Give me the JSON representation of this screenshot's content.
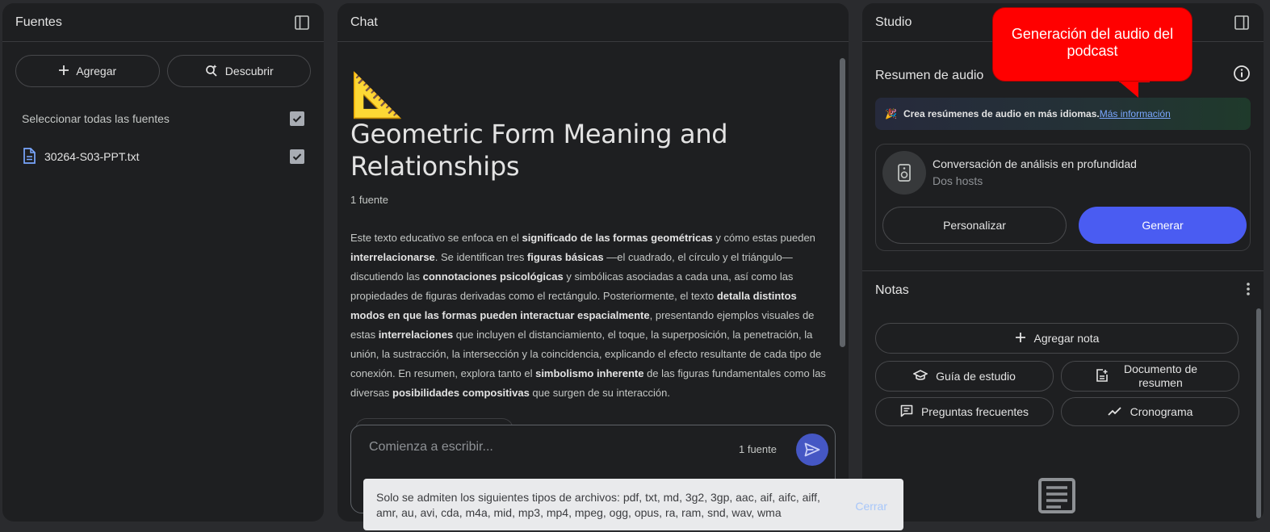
{
  "sources": {
    "title": "Fuentes",
    "add_label": "Agregar",
    "discover_label": "Descubrir",
    "select_all_label": "Seleccionar todas las fuentes",
    "items": [
      {
        "name": "30264-S03-PPT.txt",
        "checked": true
      }
    ]
  },
  "chat": {
    "title": "Chat",
    "emoji": "📐",
    "notebook_title": "Geometric Form Meaning and Relationships",
    "source_count": "1 fuente",
    "summary_parts": [
      {
        "t": "Este texto educativo se enfoca en el ",
        "b": false
      },
      {
        "t": "significado de las formas geométricas",
        "b": true
      },
      {
        "t": " y cómo estas pueden ",
        "b": false
      },
      {
        "t": "interrelacionarse",
        "b": true
      },
      {
        "t": ". Se identifican tres ",
        "b": false
      },
      {
        "t": "figuras básicas",
        "b": true
      },
      {
        "t": " —el cuadrado, el círculo y el triángulo— discutiendo las ",
        "b": false
      },
      {
        "t": "connotaciones psicológicas",
        "b": true
      },
      {
        "t": " y simbólicas asociadas a cada una, así como las propiedades de figuras derivadas como el rectángulo. Posteriormente, el texto ",
        "b": false
      },
      {
        "t": "detalla distintos modos en que las formas pueden interactuar espacialmente",
        "b": true
      },
      {
        "t": ", presentando ejemplos visuales de estas ",
        "b": false
      },
      {
        "t": "interrelaciones",
        "b": true
      },
      {
        "t": " que incluyen el distanciamiento, el toque, la superposición, la penetración, la unión, la sustracción, la intersección y la coincidencia, explicando el efecto resultante de cada tipo de conexión. En resumen, explora tanto el ",
        "b": false
      },
      {
        "t": "simbolismo inherente",
        "b": true
      },
      {
        "t": " de las figuras fundamentales como las diversas ",
        "b": false
      },
      {
        "t": "posibilidades compositivas",
        "b": true
      },
      {
        "t": " que surgen de su interacción.",
        "b": false
      }
    ],
    "input_placeholder": "Comienza a escribir...",
    "input_source_count": "1 fuente"
  },
  "studio": {
    "title": "Studio",
    "audio_title": "Resumen de audio",
    "banner_emoji": "🎉",
    "banner_text": "Crea resúmenes de audio en más idiomas.",
    "banner_link": "Más información",
    "conversation_title": "Conversación de análisis en profundidad",
    "conversation_sub": "Dos hosts",
    "customize_label": "Personalizar",
    "generate_label": "Generar",
    "notes_title": "Notas",
    "add_note_label": "Agregar nota",
    "study_guide_label": "Guía de estudio",
    "summary_doc_label": "Documento de resumen",
    "faq_label": "Preguntas frecuentes",
    "timeline_label": "Cronograma"
  },
  "callout": {
    "text": "Generación del audio del podcast"
  },
  "toast": {
    "message": "Solo se admiten los siguientes tipos de archivos: pdf, txt, md, 3g2, 3gp, aac, aif, aifc, aiff, amr, au, avi, cda, m4a, mid, mp3, mp4, mpeg, ogg, opus, ra, ram, snd, wav, wma",
    "close_label": "Cerrar"
  },
  "colors": {
    "primary": "#4a5cf2",
    "callout": "#ff0000",
    "panel": "#1e1f21"
  }
}
